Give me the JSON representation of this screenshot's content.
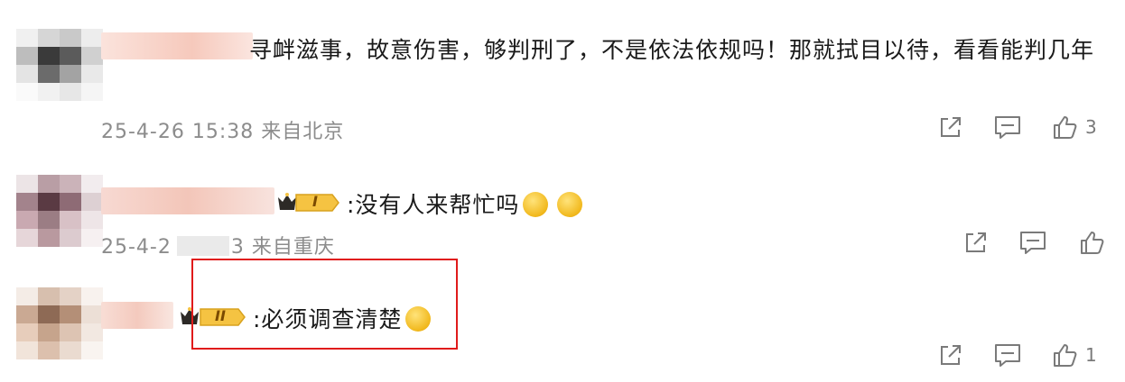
{
  "comments": [
    {
      "text": "寻衅滋事，故意伤害，够判刑了，不是依法依规吗！那就拭目以待，看看能判几年",
      "time": "25-4-26 15:38",
      "location": "来自北京",
      "like_count": "3"
    },
    {
      "text": ":没有人来帮忙吗",
      "time": "25-4-2",
      "time_tail": "3",
      "location": "来自重庆",
      "badge_level": "I"
    },
    {
      "text": ":必须调查清楚",
      "badge_level": "II",
      "like_count": "1"
    }
  ],
  "colors": {
    "highlight_border": "#e01b1b",
    "meta_text": "#8c8c8c",
    "badge_gold": "#f5c342"
  },
  "icons": [
    "share-icon",
    "comment-icon",
    "like-icon",
    "crown-icon",
    "smile-emoji-icon"
  ]
}
